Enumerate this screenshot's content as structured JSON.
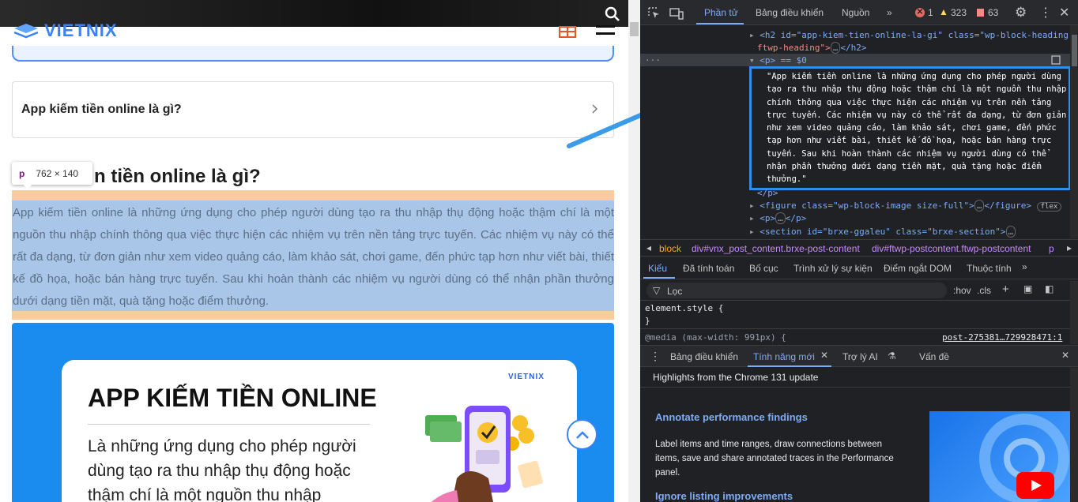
{
  "page": {
    "logo_text": "VIETNIX",
    "toc_title": "App kiếm tiền online là gì?",
    "heading": "App kiếm tiền online là gì?",
    "heading_visible": "n tiền online là gì?",
    "inspect_tag": {
      "tag": "p",
      "size": "762 × 140"
    },
    "paragraph": "App kiếm tiền online là những ứng dụng cho phép người dùng tạo ra thu nhập thụ động hoặc thậm chí là một nguồn thu nhập chính thông qua việc thực hiện các nhiệm vụ trên nền tảng trực tuyến. Các nhiệm vụ này có thể rất đa dạng, từ đơn giản như xem video quảng cáo, làm khảo sát, chơi game, đến phức tạp hơn như viết bài, thiết kế đồ họa, hoặc bán hàng trực tuyến. Sau khi hoàn thành các nhiệm vụ người dùng có thể nhận phần thưởng dưới dạng tiền mặt, quà tặng hoặc điểm thưởng.",
    "banner": {
      "logo": "VIETNIX",
      "title": "APP KIẾM TIỀN ONLINE",
      "text": "Là những ứng dụng cho phép người dùng tạo ra thu nhập thụ động hoặc thậm chí là một nguồn thu nhập"
    }
  },
  "devtools": {
    "tabs": [
      "Phần tử",
      "Bảng điều khiển",
      "Nguồn"
    ],
    "errors": "1",
    "warnings": "323",
    "issues": "63",
    "code": {
      "h2_open": "<h2 id=\"app-kiem-tien-online-la-gi\" class=\"wp-block-heading",
      "h2_cont": "ftwp-heading\">",
      "h2_close": "</h2>",
      "p_selected": "<p> == $0",
      "p_text": "\"App kiếm tiền online là những ứng dụng cho phép người dùng tạo ra thu nhập thụ động hoặc thậm chí là một nguồn thu nhập chính thông qua việc thực hiện các nhiệm vụ trên nền tảng trực tuyến. Các nhiệm vụ này có thể rất đa dạng, từ đơn giản như xem video quảng cáo, làm khảo sát, chơi game, đến phức tạp hơn như viết bài, thiết kế đồ họa, hoặc bán hàng trực tuyến. Sau khi hoàn thành các nhiệm vụ người dùng có thể nhận phần thưởng dưới dạng tiền mặt, quà tặng hoặc điểm thưởng.\"",
      "p_close": "</p>",
      "figure": "<figure class=\"wp-block-image size-full\">",
      "figure_close": "</figure>",
      "flex_badge": "flex",
      "p2": "<p>",
      "p2_close": "</p>",
      "section": "<section id=\"brxe-ggaleu\" class=\"brxe-section\">"
    },
    "breadcrumbs": [
      "block",
      "div#vnx_post_content.brxe-post-content",
      "div#ftwp-postcontent.ftwp-postcontent",
      "p"
    ],
    "style_tabs": [
      "Kiểu",
      "Đã tính toán",
      "Bố cục",
      "Trình xử lý sự kiện",
      "Điểm ngắt DOM",
      "Thuộc tính"
    ],
    "filter_placeholder": "Lọc",
    "hov": ":hov",
    "cls": ".cls",
    "styles": {
      "element_style": "element.style {",
      "close_brace": "}",
      "media": "@media (max-width: 991px) {",
      "source": "post-275381…729928471:1"
    },
    "drawer_tabs": [
      "Bảng điều khiển",
      "Tính năng mới",
      "Trợ lý AI",
      "Vấn đề"
    ],
    "whats_new": {
      "header": "Highlights from the Chrome 131 update",
      "item1_title": "Annotate performance findings",
      "item1_text": "Label items and time ranges, draw connections between items, save and share annotated traces in the Performance panel.",
      "item2_title": "Ignore listing improvements"
    }
  }
}
